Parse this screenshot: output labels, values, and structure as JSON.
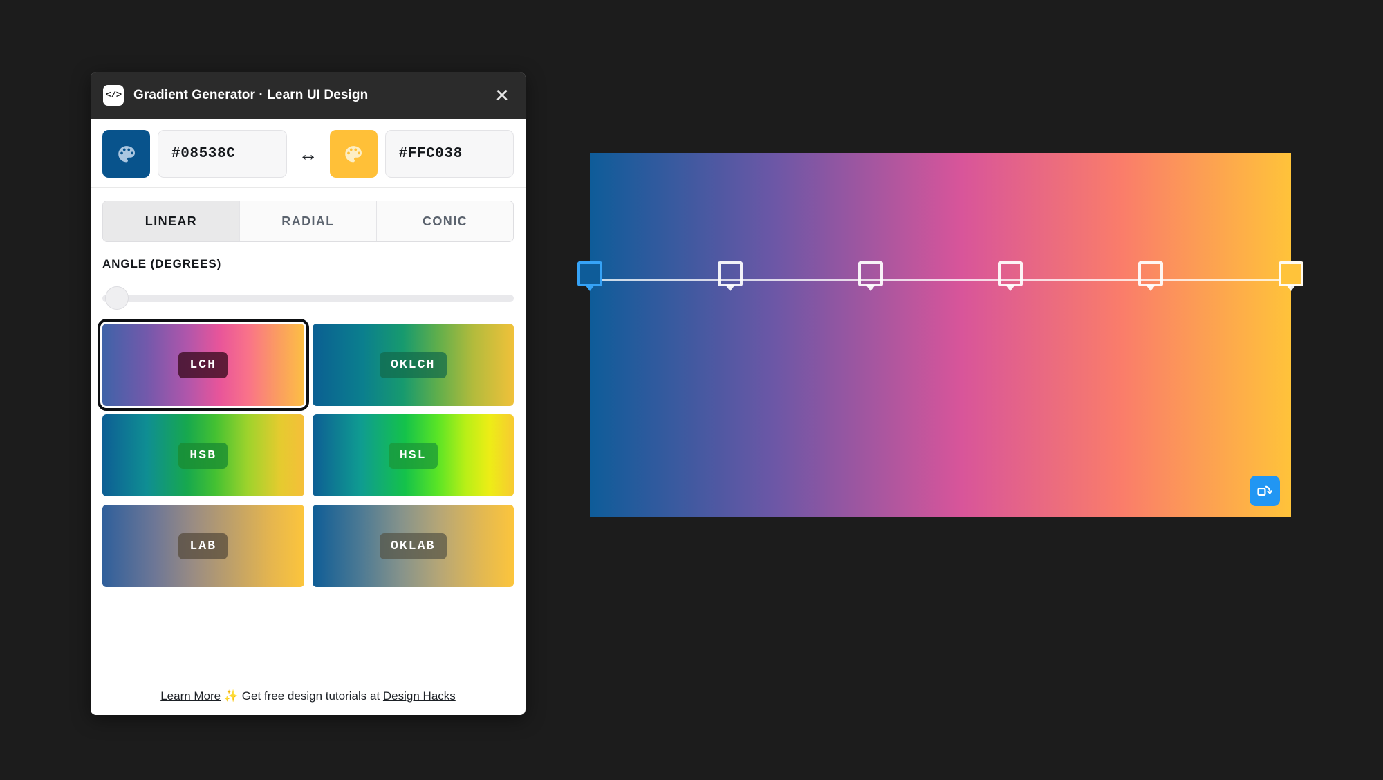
{
  "window": {
    "title": "Gradient Generator · Learn UI Design",
    "app_icon": "code-icon",
    "close_icon": "close-icon"
  },
  "colors": {
    "start_hex": "#08538C",
    "end_hex": "#FFC038",
    "start_swatch_icon": "palette-icon",
    "end_swatch_icon": "palette-icon",
    "swap_icon": "↔",
    "accent_blue": "#2196F3",
    "panel_bg": "#FFFFFF",
    "titlebar_bg": "#2B2B2B",
    "page_bg": "#1C1C1C"
  },
  "tabs": [
    {
      "label": "LINEAR",
      "active": true
    },
    {
      "label": "RADIAL",
      "active": false
    },
    {
      "label": "CONIC",
      "active": false
    }
  ],
  "angle": {
    "label": "ANGLE (DEGREES)",
    "value": 0,
    "min": 0,
    "max": 360
  },
  "color_spaces": [
    {
      "label": "LCH",
      "selected": true,
      "pill_bg": "rgba(60,12,32,0.80)",
      "gradient": "linear-gradient(90deg,#3f63a8 0%,#7359ab 22%,#b056ab 42%,#e8559a 58%,#f9728a 72%,#fb9a63 86%,#fcbf44 100%)"
    },
    {
      "label": "OKLCH",
      "selected": false,
      "pill_bg": "rgba(18,105,75,0.72)",
      "gradient": "linear-gradient(90deg,#0b5f92 0%,#0b7f8e 25%,#179a6e 45%,#5fae4c 62%,#b3bb3c 80%,#f0c13a 100%)"
    },
    {
      "label": "HSB",
      "selected": false,
      "pill_bg": "rgba(26,140,50,0.78)",
      "gradient": "linear-gradient(90deg,#0d5e94 0%,#0f8e93 22%,#17a84e 42%,#44c132 56%,#9ed32c 72%,#e5cb2f 88%,#f5bf3a 100%)"
    },
    {
      "label": "HSL",
      "selected": false,
      "pill_bg": "rgba(26,150,56,0.72)",
      "gradient": "linear-gradient(90deg,#0d5e94 0%,#0f9c91 24%,#14c24a 46%,#59e426 62%,#b8ef17 76%,#eded16 88%,#f7ca31 100%)"
    },
    {
      "label": "LAB",
      "selected": false,
      "pill_bg": "rgba(84,74,58,0.72)",
      "gradient": "linear-gradient(90deg,#2f5f9b 0%,#6e7796 26%,#9a8c83 45%,#c0a168 65%,#e6b64e 84%,#fcc53c 100%)"
    },
    {
      "label": "OKLAB",
      "selected": false,
      "pill_bg": "rgba(84,82,68,0.70)",
      "gradient": "linear-gradient(90deg,#0f5d96 0%,#4d7a94 24%,#86938b 44%,#b8a775 64%,#e2b852 84%,#fcc53c 100%)"
    }
  ],
  "footer": {
    "learn_more": "Learn More",
    "sparkle": "✨",
    "text": "Get free design tutorials at",
    "design_hacks": "Design Hacks"
  },
  "canvas": {
    "gradient_css": "linear-gradient(90deg,#0e5c99 0%,#6b57a6 26%,#d8559a 53%,#fa7d6a 76%,#ffc33a 100%)",
    "regen_icon": "refresh-square-icon",
    "stops": [
      {
        "position_pct": 0,
        "color": "#0E5C99",
        "active": true
      },
      {
        "position_pct": 20,
        "color": "#6B57A6",
        "active": false
      },
      {
        "position_pct": 40,
        "color": "#A45AA6",
        "active": false
      },
      {
        "position_pct": 60,
        "color": "#E8559A",
        "active": false
      },
      {
        "position_pct": 80,
        "color": "#FA8A62",
        "active": false
      },
      {
        "position_pct": 100,
        "color": "#FFC33A",
        "active": false
      }
    ]
  }
}
